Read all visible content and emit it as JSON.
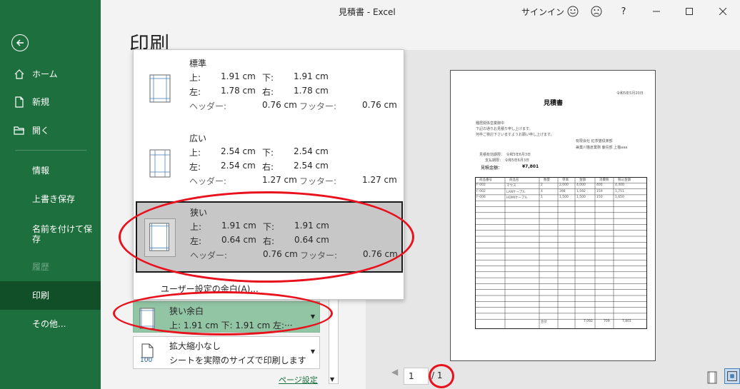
{
  "window": {
    "title": "見積書  -  Excel",
    "signin": "サインイン"
  },
  "sidebar": {
    "items": [
      {
        "label": "ホーム",
        "icon": "home-icon"
      },
      {
        "label": "新規",
        "icon": "new-document-icon"
      },
      {
        "label": "開く",
        "icon": "open-folder-icon"
      },
      {
        "label": "情報"
      },
      {
        "label": "上書き保存"
      },
      {
        "label": "名前を付けて保存"
      },
      {
        "label": "履歴"
      },
      {
        "label": "印刷"
      },
      {
        "label": "その他..."
      }
    ]
  },
  "page": {
    "heading": "印刷"
  },
  "margin_menu": {
    "options": [
      {
        "name": "標準",
        "top_label": "上:",
        "top": "1.91 cm",
        "bottom_label": "下:",
        "bottom": "1.91 cm",
        "left_label": "左:",
        "left": "1.78 cm",
        "right_label": "右:",
        "right": "1.78 cm",
        "header_label": "ヘッダー:",
        "header": "0.76 cm",
        "footer_label": "フッター:",
        "footer": "0.76 cm"
      },
      {
        "name": "広い",
        "top_label": "上:",
        "top": "2.54 cm",
        "bottom_label": "下:",
        "bottom": "2.54 cm",
        "left_label": "左:",
        "left": "2.54 cm",
        "right_label": "右:",
        "right": "2.54 cm",
        "header_label": "ヘッダー:",
        "header": "1.27 cm",
        "footer_label": "フッター:",
        "footer": "1.27 cm"
      },
      {
        "name": "狭い",
        "top_label": "上:",
        "top": "1.91 cm",
        "bottom_label": "下:",
        "bottom": "1.91 cm",
        "left_label": "左:",
        "left": "0.64 cm",
        "right_label": "右:",
        "right": "0.64 cm",
        "header_label": "ヘッダー:",
        "header": "0.76 cm",
        "footer_label": "フッター:",
        "footer": "0.76 cm"
      }
    ],
    "custom": "ユーザー設定の余白(A)..."
  },
  "settings": {
    "margin": {
      "line1": "狭い余白",
      "line2": "上: 1.91 cm 下: 1.91 cm 左:···"
    },
    "scale": {
      "line1": "拡大縮小なし",
      "line2": "シートを実際のサイズで印刷します",
      "icon_text": "100"
    },
    "page_setup": "ページ設定"
  },
  "preview": {
    "date": "令和5年5月20日",
    "doc_title": "見積書",
    "greeting1": "種居関係営業御中",
    "greeting2": "下記の通りお見積り申し上げます。",
    "greeting3": "何卒ご検討下さいますようお願い申し上げます。",
    "company": "有限会社 紅茶猫倶楽部",
    "address": "兼業川猫倉業務 鹿島部 上猫aaa",
    "meta1": "見積有効期限：　令和5年6月3日",
    "meta2": "支払期限：　令和5年6月3日",
    "total_label": "見積金額：",
    "total_value": "¥7,801",
    "table_headers": [
      "商品番号",
      "商品名",
      "数量",
      "単価",
      "金額",
      "消費税",
      "税込金額"
    ],
    "rows": [
      [
        "F-002",
        "マウス",
        "2",
        "2,000",
        "4,000",
        "400",
        "4,400"
      ],
      [
        "F-002",
        "LANケーブル",
        "4",
        "398",
        "1,592",
        "159",
        "1,751"
      ],
      [
        "F-006",
        "HDMIケーブル",
        "1",
        "1,500",
        "1,500",
        "150",
        "1,650"
      ]
    ],
    "footer_label": "合計",
    "footer_values": [
      "7,092",
      "709",
      "7,801"
    ]
  },
  "page_nav": {
    "current": "1",
    "total": "/ 1"
  },
  "colors": {
    "accent": "#1e6f3e",
    "annotation": "#e8111c"
  }
}
